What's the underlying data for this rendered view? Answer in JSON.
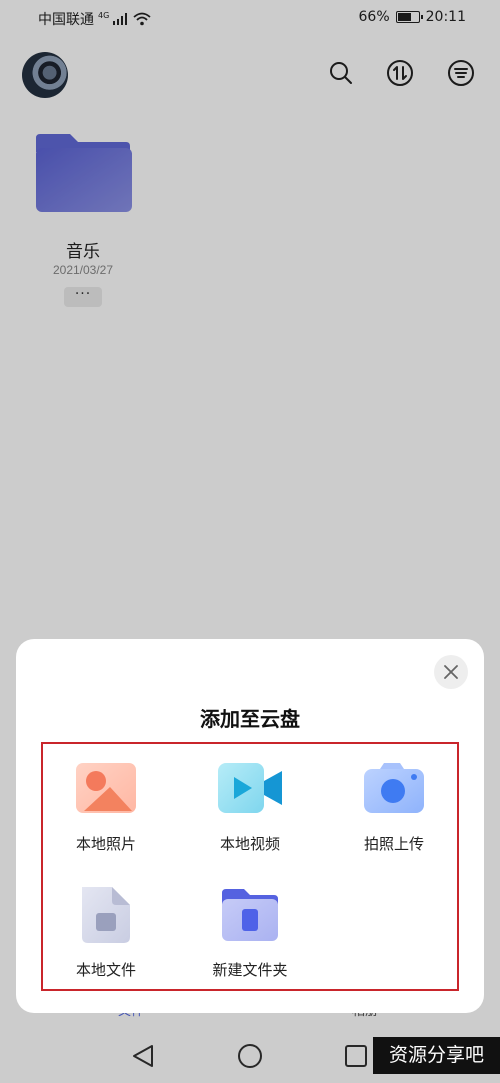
{
  "status_bar": {
    "carrier": "中国联通",
    "network": "4G",
    "battery_percent": "66%",
    "battery_level": 0.66,
    "time": "20:11"
  },
  "header": {
    "icons": [
      "search-icon",
      "transfer-icon",
      "sort-menu-icon"
    ]
  },
  "files": [
    {
      "name": "音乐",
      "date": "2021/03/27",
      "more_label": "···"
    }
  ],
  "bottom_nav": {
    "left_label": "文件",
    "right_label": "相册"
  },
  "sheet": {
    "title": "添加至云盘",
    "options": [
      {
        "label": "本地照片",
        "icon": "local-photo-icon"
      },
      {
        "label": "本地视频",
        "icon": "local-video-icon"
      },
      {
        "label": "拍照上传",
        "icon": "camera-upload-icon"
      },
      {
        "label": "本地文件",
        "icon": "local-file-icon"
      },
      {
        "label": "新建文件夹",
        "icon": "new-folder-icon"
      }
    ]
  },
  "watermark": "资源分享吧",
  "colors": {
    "accent": "#5b6ee1",
    "highlight_border": "#c9252b",
    "folder": "#6f76d8"
  }
}
